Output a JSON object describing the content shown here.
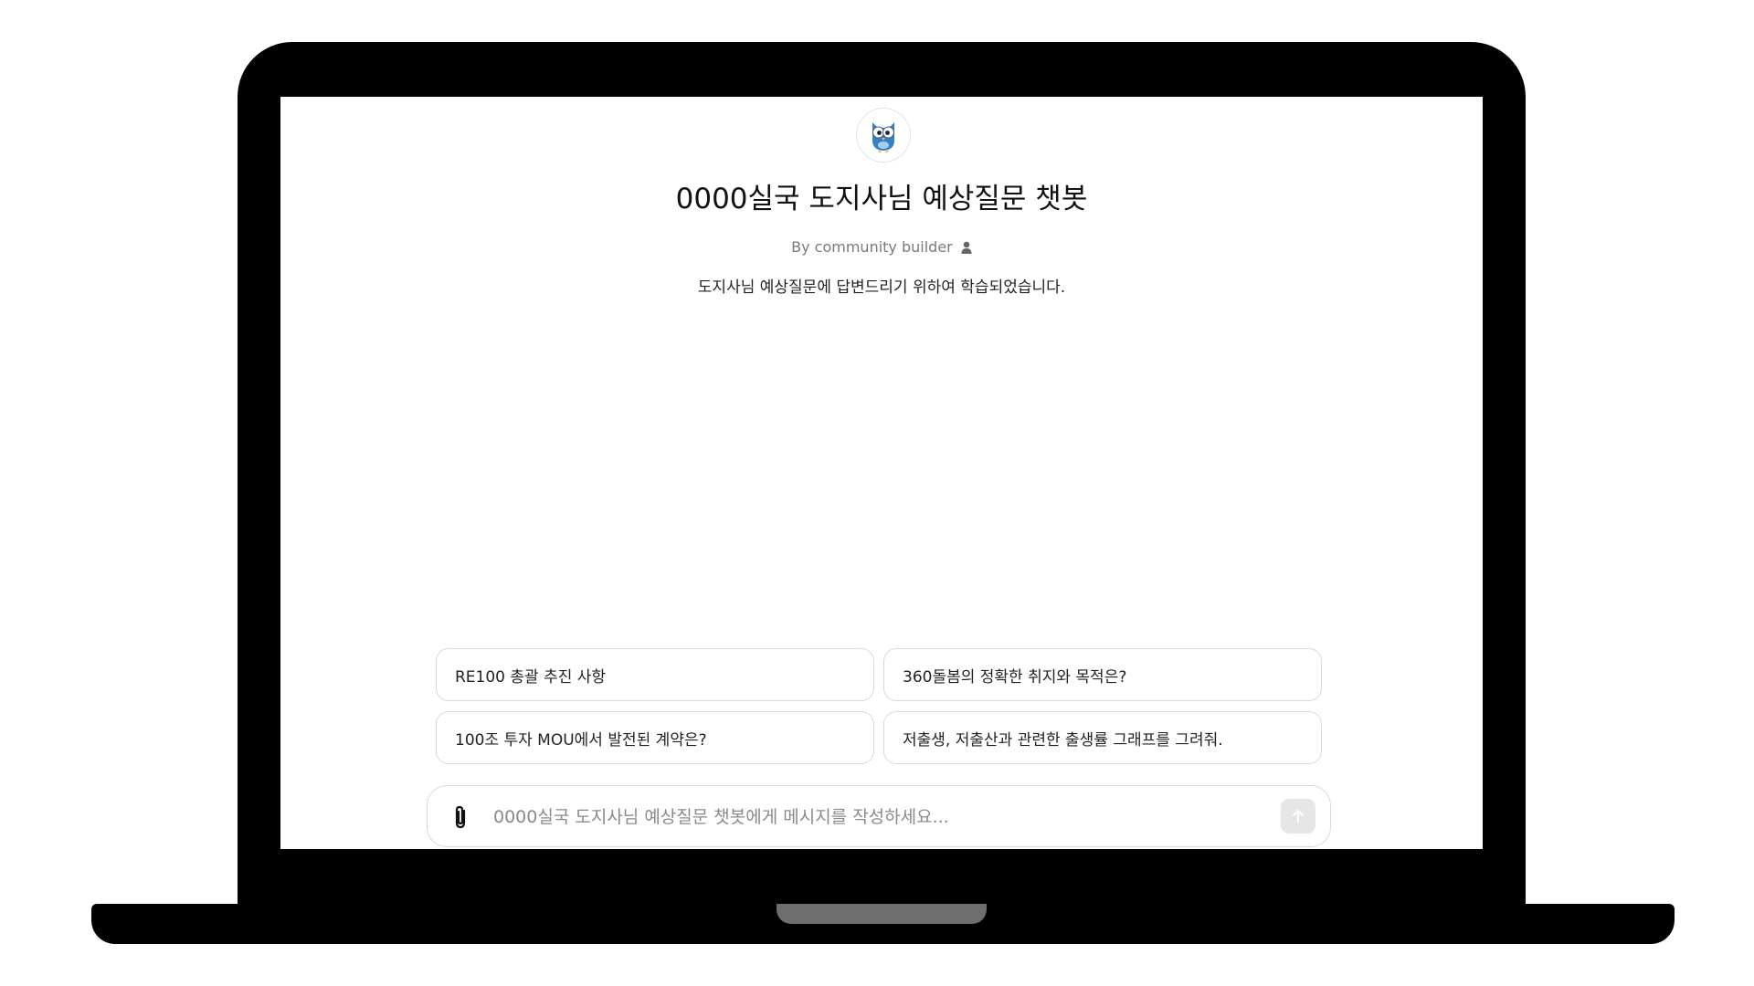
{
  "gpt": {
    "avatar_icon": "owl-icon",
    "title": "0000실국 도지사님 예상질문 챗봇",
    "byline": "By community builder",
    "description": "도지사님 예상질문에 답변드리기 위하여 학습되었습니다."
  },
  "suggestions": [
    {
      "label": "RE100 총괄 추진 사항"
    },
    {
      "label": "360돌봄의 정확한 취지와 목적은?"
    },
    {
      "label": "100조 투자 MOU에서 발전된 계약은?"
    },
    {
      "label": "저출생, 저출산과 관련한 출생률 그래프를 그려줘."
    }
  ],
  "composer": {
    "placeholder": "0000실국 도지사님 예상질문 챗봇에게 메시지를 작성하세요...",
    "value": "",
    "attach_icon": "paperclip-icon",
    "send_icon": "arrow-up-icon"
  },
  "colors": {
    "frame": "#000000",
    "screen": "#ffffff",
    "chip_border": "#d9d9d9",
    "owl_blue": "#3a7fc4"
  }
}
